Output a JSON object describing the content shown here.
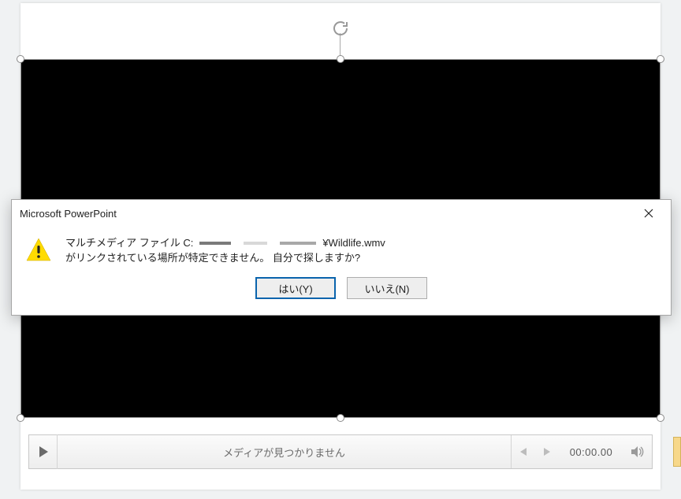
{
  "dialog": {
    "title": "Microsoft PowerPoint",
    "message_pre": "マルチメディア ファイル C:",
    "message_file": "¥Wildlife.wmv",
    "message_post": " がリンクされている場所が特定できません。 自分で探しますか?",
    "yes_label": "はい(Y)",
    "no_label": "いいえ(N)"
  },
  "media": {
    "status_text": "メディアが見つかりません",
    "time": "00:00.00"
  }
}
